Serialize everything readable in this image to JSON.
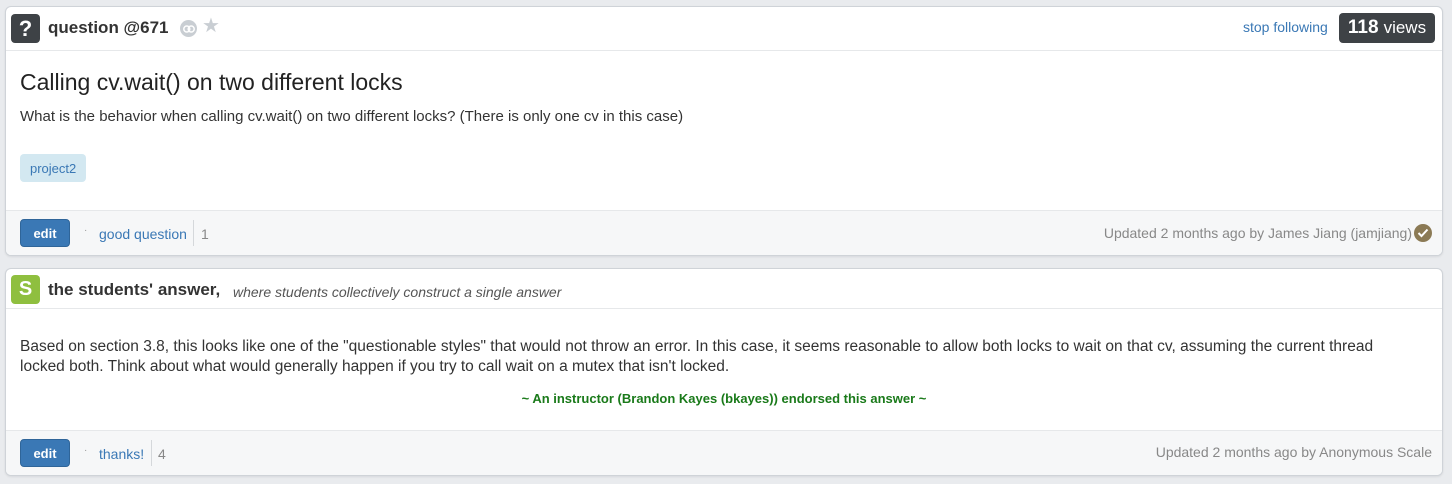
{
  "question": {
    "badge_glyph": "?",
    "header_title": "question @671",
    "stop_following": "stop following",
    "views_count": "118",
    "views_label": "views",
    "title": "Calling cv.wait() on two different locks",
    "body": "What is the behavior when calling cv.wait() on two different locks? (There is only one cv in this case)",
    "tag": "project2",
    "footer": {
      "edit_label": "edit",
      "dot": "·",
      "action_label": "good question",
      "count": "1",
      "updated_text": "Updated 2 months ago by James Jiang (jamjiang)"
    }
  },
  "answer": {
    "badge_glyph": "S",
    "header_title": "the students' answer,",
    "header_subtitle": "where students collectively construct a single answer",
    "body": "Based on section 3.8, this looks like one of the \"questionable styles\" that would not throw an error. In this case, it seems reasonable to allow both locks to wait on that cv, assuming the current thread locked both. Think about what would generally happen if you try to call wait on a mutex that isn't locked.",
    "endorsement": "~ An instructor (Brandon Kayes (bkayes)) endorsed this answer  ~",
    "footer": {
      "edit_label": "edit",
      "dot": "·",
      "action_label": "thanks!",
      "count": "4",
      "updated_text": "Updated 2 months ago by Anonymous Scale"
    }
  },
  "icons": {
    "question_badge": "question-mark-badge-icon",
    "link": "link-icon",
    "star": "star-icon",
    "student_badge": "students-s-badge-icon",
    "verified": "check-circle-icon"
  },
  "colors": {
    "accent_blue": "#3a78b5",
    "dark_badge": "#3e4246",
    "student_green": "#8fbf3f",
    "endorse_green": "#1a7a1a",
    "tag_bg": "#d3e8f1"
  }
}
